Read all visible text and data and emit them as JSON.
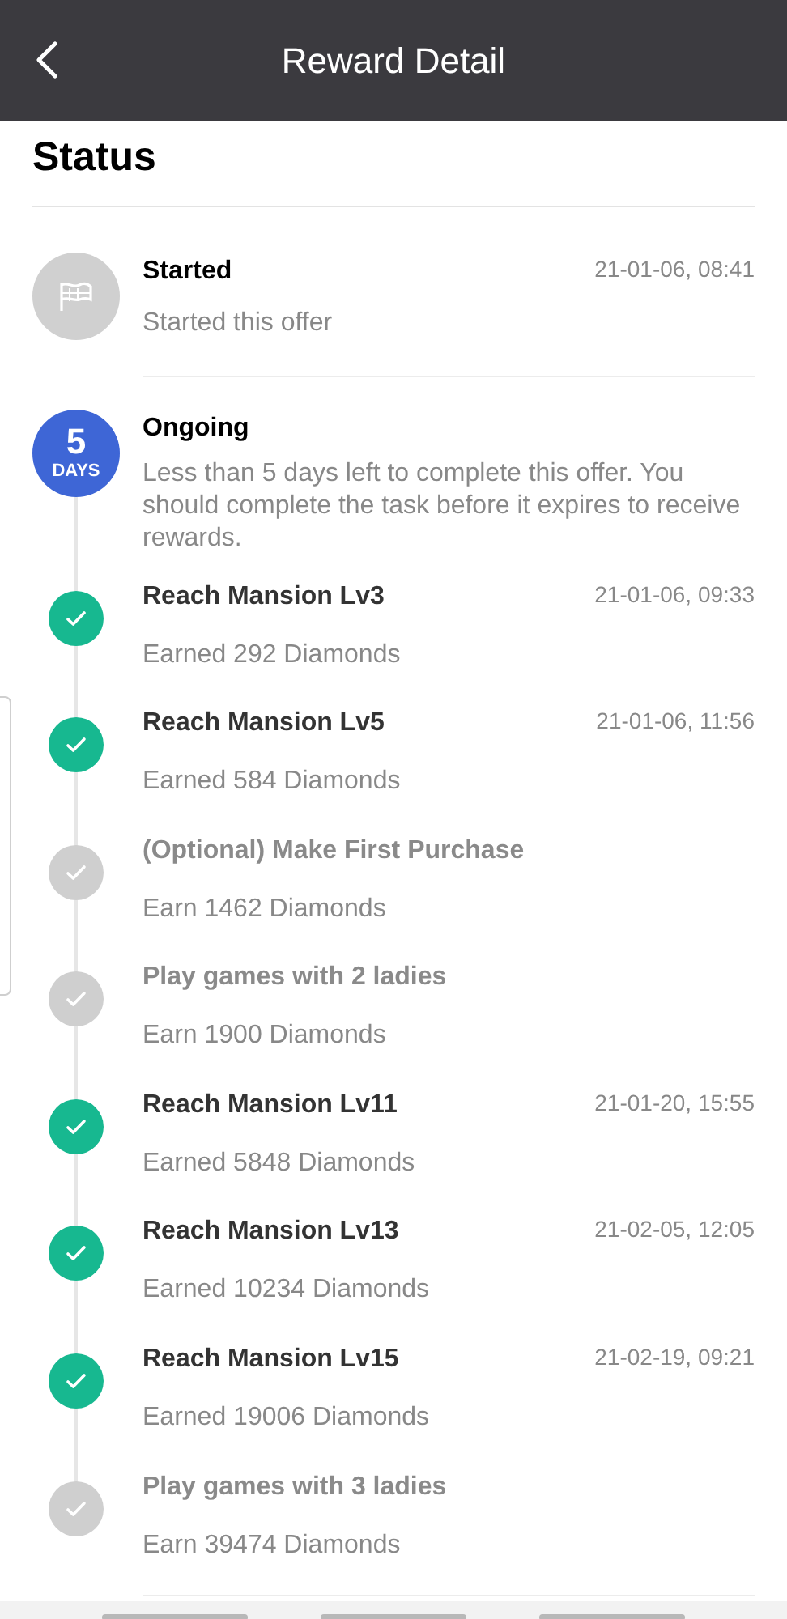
{
  "header": {
    "title": "Reward Detail"
  },
  "section_title": "Status",
  "started": {
    "title": "Started",
    "time": "21-01-06, 08:41",
    "text": "Started this offer"
  },
  "ongoing": {
    "badge_number": "5",
    "badge_unit": "DAYS",
    "title": "Ongoing",
    "text": "Less than 5 days left to complete this offer. You should complete the task before it expires to receive rewards."
  },
  "steps": [
    {
      "title": "Reach Mansion Lv3",
      "time": "21-01-06, 09:33",
      "reward": "Earned 292 Diamonds",
      "done": true
    },
    {
      "title": "Reach Mansion Lv5",
      "time": "21-01-06, 11:56",
      "reward": "Earned 584 Diamonds",
      "done": true
    },
    {
      "title": "(Optional) Make First Purchase",
      "reward": "Earn 1462 Diamonds",
      "done": false
    },
    {
      "title": "Play games with 2 ladies",
      "reward": "Earn 1900 Diamonds",
      "done": false
    },
    {
      "title": "Reach Mansion Lv11",
      "time": "21-01-20, 15:55",
      "reward": "Earned 5848 Diamonds",
      "done": true
    },
    {
      "title": "Reach Mansion Lv13",
      "time": "21-02-05, 12:05",
      "reward": "Earned 10234 Diamonds",
      "done": true
    },
    {
      "title": "Reach Mansion Lv15",
      "time": "21-02-19, 09:21",
      "reward": "Earned 19006 Diamonds",
      "done": true
    },
    {
      "title": "Play games with 3 ladies",
      "reward": "Earn 39474 Diamonds",
      "done": false
    }
  ]
}
